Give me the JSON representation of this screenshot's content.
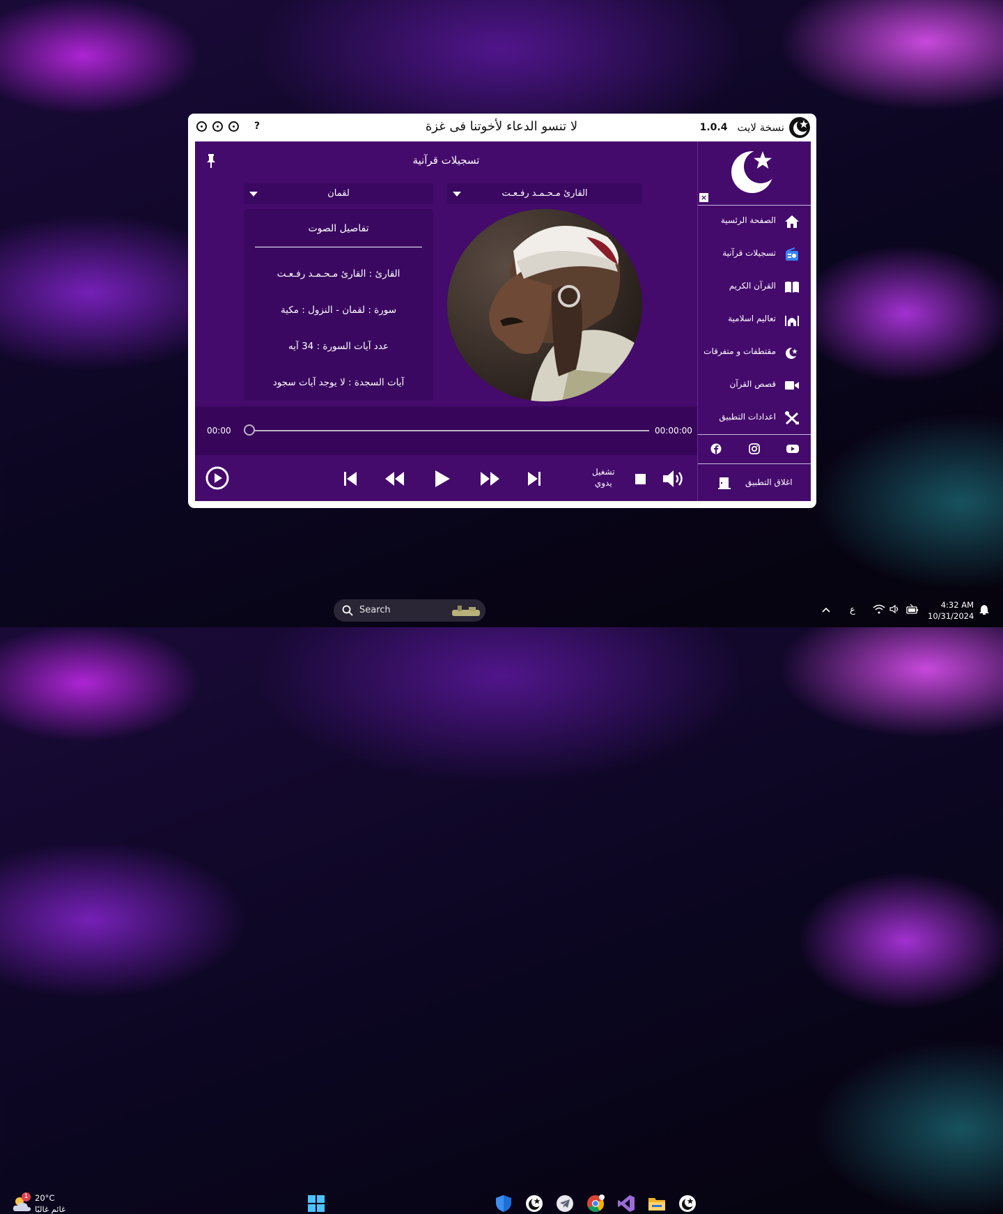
{
  "window": {
    "help_label": "?",
    "banner": "لا تنسو الدعاء لأخوتنا فى غزة",
    "version": "1.0.4",
    "version_label": "نسخة لايت"
  },
  "main": {
    "title": "تسجيلات قرآنية",
    "reciter_select": "القارئ مـحـمـد رفـعـت",
    "surah_select": "لقمان",
    "details": {
      "heading": "تفاصيل الصوت",
      "reciter_row": "القارئ : القارئ مـحـمـد رفـعـت",
      "surah_row": "سورة  :  لقمان  -  النزول  :  مكية",
      "ayat_row": "عدد آيات السورة :  34  آيه",
      "sajda_row": "آيات السجدة  :  لا يوجد آيات سجود"
    },
    "time_start": "00:00",
    "time_end": "00:00:00",
    "progress": 0,
    "manual_line1": "تشغيل",
    "manual_line2": "يدوي"
  },
  "sidebar": {
    "close_label": "×",
    "items": [
      {
        "label": "الصفحة الرئسية",
        "icon": "home-icon"
      },
      {
        "label": "تسجيلات قرآنية",
        "icon": "radio-icon"
      },
      {
        "label": "القرآن الكريم",
        "icon": "book-icon"
      },
      {
        "label": "تعاليم اسلامية",
        "icon": "mosque-icon"
      },
      {
        "label": "مقتطفات و متفرقات",
        "icon": "crescent-icon"
      },
      {
        "label": "قصص القرآن",
        "icon": "video-icon"
      },
      {
        "label": "اعدادات التطبيق",
        "icon": "tools-icon"
      }
    ],
    "exit_label": "اغلاق التطبيق"
  },
  "taskbar": {
    "weather_temp": "20°C",
    "weather_desc": "غائم غالبًا",
    "weather_badge": "1",
    "search_placeholder": "Search",
    "lang": "ع",
    "time": "4:32 AM",
    "date": "10/31/2024"
  },
  "colors": {
    "panel": "#440a6c",
    "panel_dark": "#37065a",
    "accent_blue": "#3b82f6"
  }
}
